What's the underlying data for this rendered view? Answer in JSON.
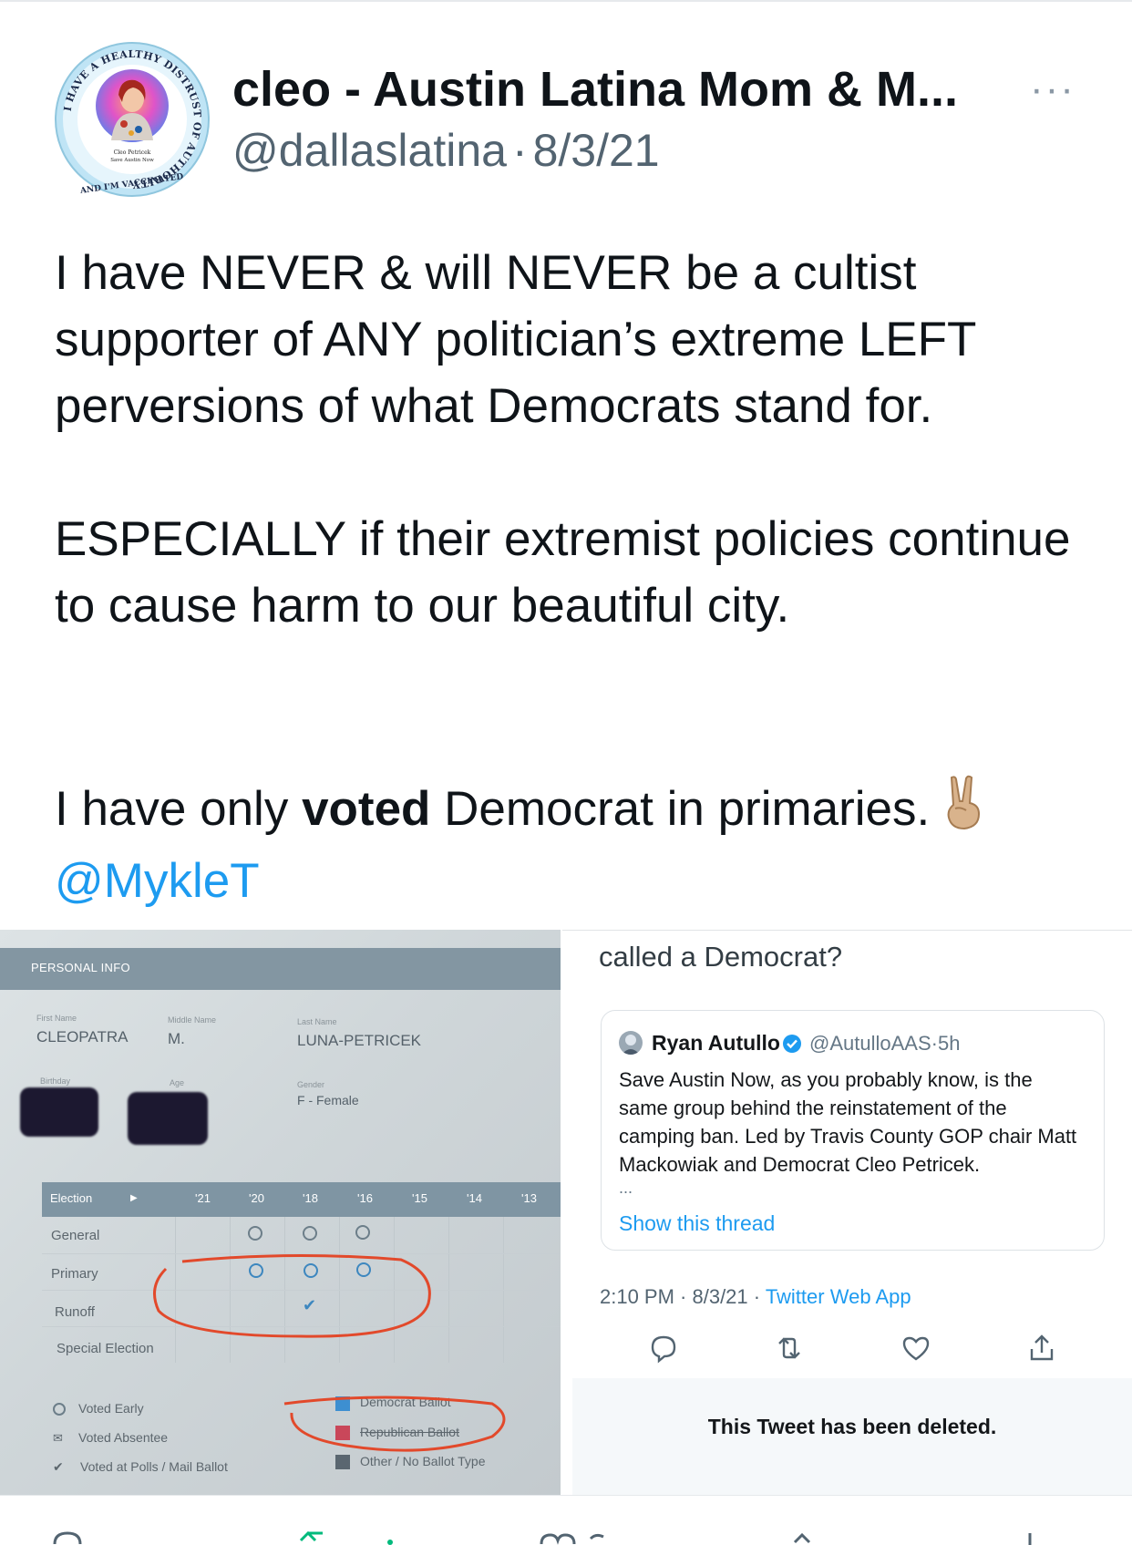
{
  "tweet": {
    "avatar": {
      "ring_text": "I HAVE A HEALTHY DISTRUST OF AUTHORITY",
      "bottom_text": "AND I'M VACCINATED",
      "caption_line1": "Cleo Petricek",
      "caption_line2": "Save Austin Now"
    },
    "author_name": "cleo - Austin Latina Mom & M...",
    "handle": "@dallaslatina",
    "separator": "·",
    "date": "8/3/21",
    "more_icon": "···",
    "paragraph1": "I have NEVER & will NEVER be a cultist supporter of ANY politician’s extreme LEFT perversions of what Democrats stand for.",
    "paragraph2": "ESPECIALLY if their extremist policies continue to cause harm to our beautiful city.",
    "paragraph3_before": "I have only ",
    "paragraph3_bold": "voted",
    "paragraph3_after": " Democrat in primaries.",
    "emoji": "victory-hand",
    "mention": "@MykleT"
  },
  "media_left": {
    "section_title": "PERSONAL INFO",
    "first_name_label": "First Name",
    "first_name": "CLEOPATRA",
    "middle_name_label": "Middle Name",
    "middle_name": "M.",
    "last_name_label": "Last Name",
    "last_name": "LUNA-PETRICEK",
    "birthday_label": "Birthday",
    "age_label": "Age",
    "gender_label": "Gender",
    "gender": "F - Female",
    "table_header": [
      "Election",
      "'21",
      "'20",
      "'18",
      "'16",
      "'15",
      "'14",
      "'13"
    ],
    "rows": [
      "General",
      "Primary",
      "Runoff",
      "Special Election"
    ],
    "legend_left": [
      "Voted Early",
      "Voted Absentee",
      "Voted at Polls / Mail Ballot"
    ],
    "legend_right": [
      "Democrat Ballot",
      "Republican Ballot",
      "Other / No Ballot Type"
    ],
    "colors": {
      "democrat": "#3d8fd1",
      "republican": "#c9475a",
      "other": "#5a6670",
      "annotation": "#e2492b"
    }
  },
  "media_right": {
    "top_text": "called a Democrat?",
    "quoted": {
      "name": "Ryan Autullo",
      "handle": "@AutulloAAS",
      "separator": "·",
      "time": "5h",
      "text": "Save Austin Now, as you probably know, is the same group behind the reinstatement of the camping ban. Led by Travis County GOP chair Matt Mackowiak and Democrat Cleo Petricek.",
      "ellipsis": "...",
      "show_thread": "Show this thread"
    },
    "meta_time": "2:10 PM · 8/3/21 · ",
    "meta_app": "Twitter Web App",
    "deleted_notice": "This Tweet has been deleted.",
    "actions": [
      "reply-icon",
      "retweet-icon",
      "like-icon",
      "share-icon"
    ]
  },
  "bottom_actions": [
    "reply-icon",
    "retweet-icon",
    "like-icon",
    "share-icon"
  ]
}
